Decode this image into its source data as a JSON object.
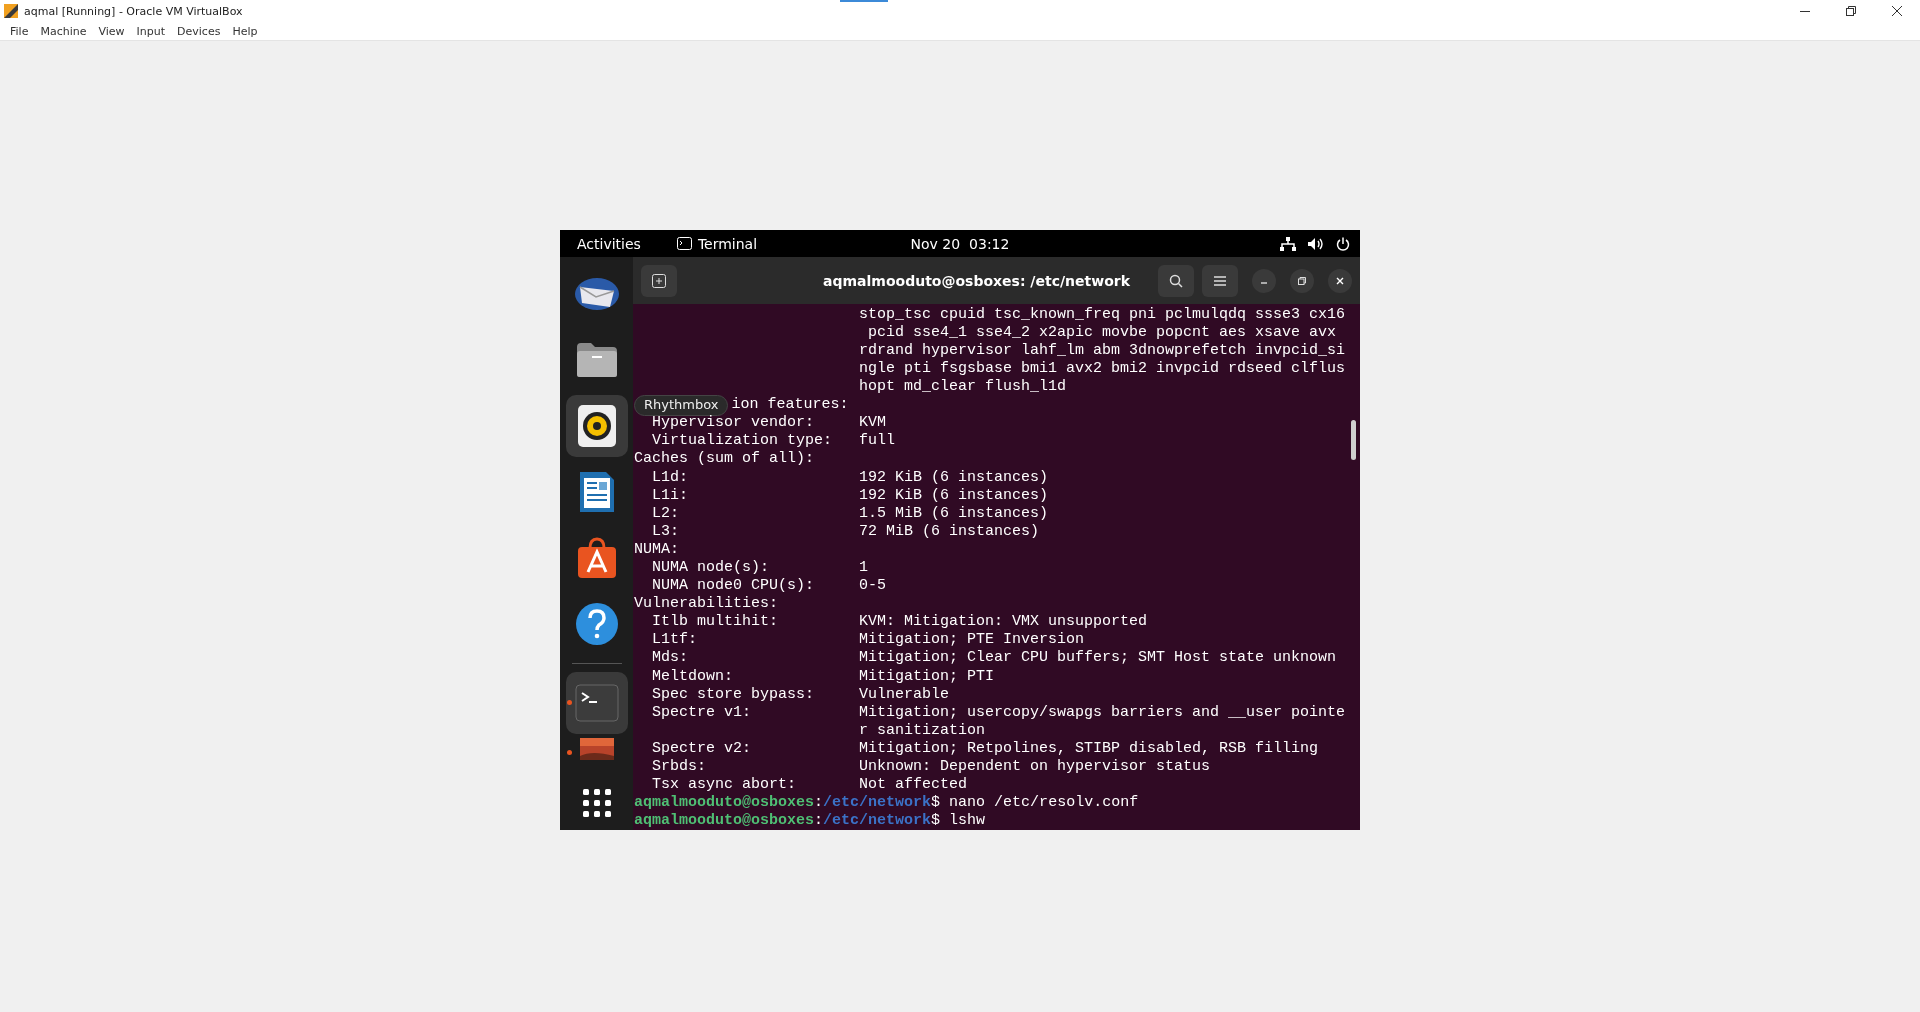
{
  "host_window": {
    "title": "aqmal [Running] - Oracle VM VirtualBox"
  },
  "menu": [
    "File",
    "Machine",
    "View",
    "Input",
    "Devices",
    "Help"
  ],
  "top_bar": {
    "activities": "Activities",
    "app": "Terminal",
    "clock": "Nov 20  03:12"
  },
  "dock": [
    {
      "kind": "mail",
      "highlighted": false,
      "running": false
    },
    {
      "kind": "files",
      "highlighted": false,
      "running": false
    },
    {
      "kind": "music",
      "highlighted": true,
      "running": false,
      "tooltip": "Rhythmbox"
    },
    {
      "kind": "writer",
      "highlighted": false,
      "running": false
    },
    {
      "kind": "store",
      "highlighted": false,
      "running": false
    },
    {
      "kind": "help",
      "highlighted": false,
      "running": false
    },
    {
      "kind": "separator"
    },
    {
      "kind": "terminal",
      "highlighted": true,
      "running": true
    },
    {
      "kind": "tile",
      "highlighted": false,
      "running": true
    },
    {
      "kind": "apps",
      "highlighted": false,
      "running": false
    }
  ],
  "terminal": {
    "title": "aqmalmooduto@osboxes: /etc/network",
    "lines": [
      {
        "kind": "wrap",
        "text": "stop_tsc cpuid tsc_known_freq pni pclmulqdq ssse3 cx16"
      },
      {
        "kind": "wrap",
        "text": " pcid sse4_1 sse4_2 x2apic movbe popcnt aes xsave avx"
      },
      {
        "kind": "wrap",
        "text": "rdrand hypervisor lahf_lm abm 3dnowprefetch invpcid_si"
      },
      {
        "kind": "wrap",
        "text": "ngle pti fsgsbase bmi1 avx2 bmi2 invpcid rdseed clflus"
      },
      {
        "kind": "wrap",
        "text": "hopt md_clear flush_l1d"
      },
      {
        "kind": "covered",
        "text": "ion features:"
      },
      {
        "kind": "field",
        "indent": true,
        "label": "Hypervisor vendor:",
        "value": "KVM"
      },
      {
        "kind": "field",
        "indent": true,
        "label": "Virtualization type:",
        "value": "full"
      },
      {
        "kind": "field",
        "indent": false,
        "label": "Caches (sum of all):"
      },
      {
        "kind": "field",
        "indent": true,
        "label": "L1d:",
        "value": "192 KiB (6 instances)"
      },
      {
        "kind": "field",
        "indent": true,
        "label": "L1i:",
        "value": "192 KiB (6 instances)"
      },
      {
        "kind": "field",
        "indent": true,
        "label": "L2:",
        "value": "1.5 MiB (6 instances)"
      },
      {
        "kind": "field",
        "indent": true,
        "label": "L3:",
        "value": "72 MiB (6 instances)"
      },
      {
        "kind": "field",
        "indent": false,
        "label": "NUMA:"
      },
      {
        "kind": "field",
        "indent": true,
        "label": "NUMA node(s):",
        "value": "1"
      },
      {
        "kind": "field",
        "indent": true,
        "label": "NUMA node0 CPU(s):",
        "value": "0-5"
      },
      {
        "kind": "field",
        "indent": false,
        "label": "Vulnerabilities:"
      },
      {
        "kind": "field",
        "indent": true,
        "label": "Itlb multihit:",
        "value": "KVM: Mitigation: VMX unsupported"
      },
      {
        "kind": "field",
        "indent": true,
        "label": "L1tf:",
        "value": "Mitigation; PTE Inversion"
      },
      {
        "kind": "field",
        "indent": true,
        "label": "Mds:",
        "value": "Mitigation; Clear CPU buffers; SMT Host state unknown"
      },
      {
        "kind": "field",
        "indent": true,
        "label": "Meltdown:",
        "value": "Mitigation; PTI"
      },
      {
        "kind": "field",
        "indent": true,
        "label": "Spec store bypass:",
        "value": "Vulnerable"
      },
      {
        "kind": "field",
        "indent": true,
        "label": "Spectre v1:",
        "value": "Mitigation; usercopy/swapgs barriers and __user pointe"
      },
      {
        "kind": "wrap",
        "text": "r sanitization"
      },
      {
        "kind": "field",
        "indent": true,
        "label": "Spectre v2:",
        "value": "Mitigation; Retpolines, STIBP disabled, RSB filling"
      },
      {
        "kind": "field",
        "indent": true,
        "label": "Srbds:",
        "value": "Unknown: Dependent on hypervisor status"
      },
      {
        "kind": "field",
        "indent": true,
        "label": "Tsx async abort:",
        "value": "Not affected"
      },
      {
        "kind": "prompt",
        "user": "aqmalmooduto@osboxes",
        "sep": ":",
        "path": "/etc/network",
        "symbol": "$",
        "command": "nano /etc/resolv.conf"
      },
      {
        "kind": "prompt",
        "user": "aqmalmooduto@osboxes",
        "sep": ":",
        "path": "/etc/network",
        "symbol": "$",
        "command": "lshw"
      }
    ]
  }
}
